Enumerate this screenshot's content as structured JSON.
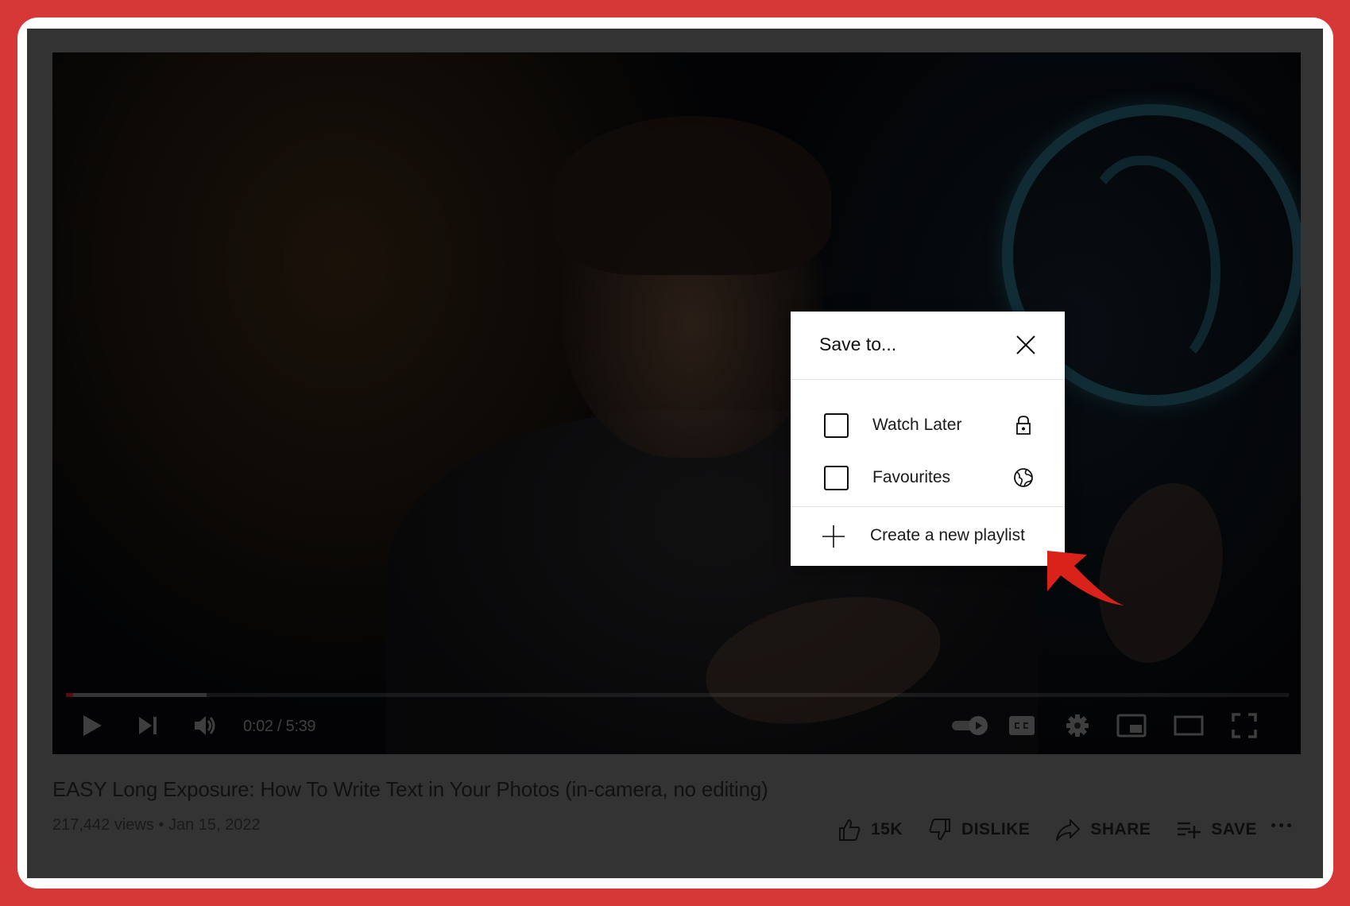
{
  "player": {
    "progress": {
      "played_fraction": 0.006,
      "buffered_fraction": 0.115
    },
    "time_display": "0:02 / 5:39",
    "controls": {
      "play": "play-icon",
      "next": "next-icon",
      "volume": "volume-icon",
      "autoplay": "autoplay-toggle-icon",
      "captions": "cc-icon",
      "settings": "gear-icon",
      "miniplayer": "miniplayer-icon",
      "theater": "theater-mode-icon",
      "fullscreen": "fullscreen-icon"
    }
  },
  "video": {
    "title": "EASY Long Exposure: How To Write Text in Your Photos (in-camera, no editing)",
    "meta": "217,442 views • Jan 15, 2022"
  },
  "actions": {
    "like_label": "15K",
    "dislike_label": "DISLIKE",
    "share_label": "SHARE",
    "save_label": "SAVE"
  },
  "dialog": {
    "title": "Save to...",
    "items": [
      {
        "label": "Watch Later",
        "checked": false,
        "privacy_icon": "lock-icon"
      },
      {
        "label": "Favourites",
        "checked": false,
        "privacy_icon": "globe-icon"
      }
    ],
    "create_label": "Create a new playlist"
  },
  "colors": {
    "frame_red": "#d63838",
    "annotation_red": "#d9221a",
    "panel_gray": "#333333"
  }
}
